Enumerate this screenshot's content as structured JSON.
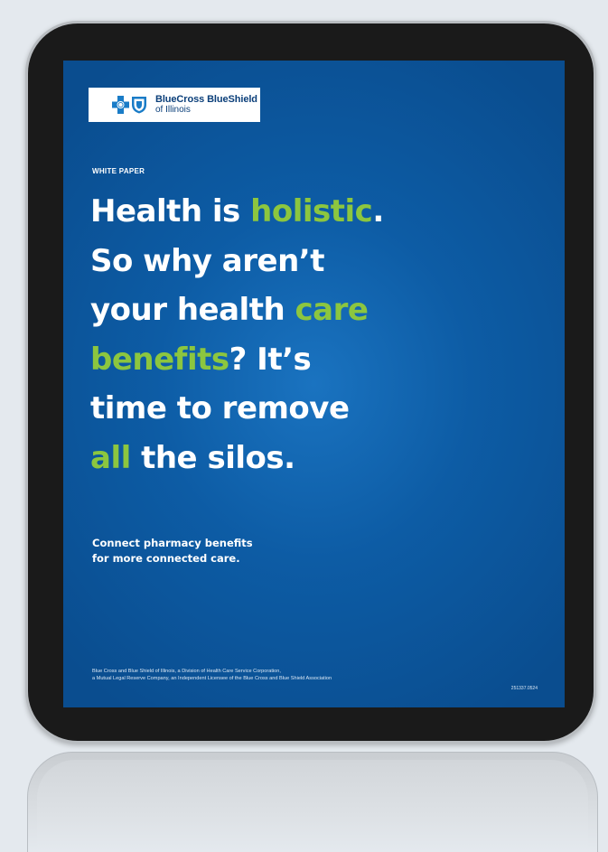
{
  "logo": {
    "brand": "BlueCross BlueShield",
    "region": "of Illinois",
    "icons": [
      "cross-icon",
      "shield-icon"
    ]
  },
  "eyebrow": "WHITE PAPER",
  "headline": {
    "lines": [
      [
        {
          "text": "Health is ",
          "highlight": false
        },
        {
          "text": "holistic",
          "highlight": true
        },
        {
          "text": ".",
          "highlight": false
        }
      ],
      [
        {
          "text": "So why aren’t",
          "highlight": false
        }
      ],
      [
        {
          "text": "your health ",
          "highlight": false
        },
        {
          "text": "care",
          "highlight": true
        }
      ],
      [
        {
          "text": "benefits",
          "highlight": true
        },
        {
          "text": "? It’s",
          "highlight": false
        }
      ],
      [
        {
          "text": "time to remove",
          "highlight": false
        }
      ],
      [
        {
          "text": "all",
          "highlight": true
        },
        {
          "text": " the silos.",
          "highlight": false
        }
      ]
    ]
  },
  "subhead": {
    "line1": "Connect pharmacy benefits",
    "line2": "for more connected care."
  },
  "footer": {
    "legal_line1": "Blue Cross and Blue Shield of Illinois, a Division of Health Care Service Corporation,",
    "legal_line2": "a Mutual Legal Reserve Company, an Independent Licensee of the Blue Cross and Blue Shield Association",
    "code": "251337.0524"
  },
  "colors": {
    "screen_blue": "#0d5ca5",
    "accent_green": "#8cc63f",
    "logo_navy": "#0b3f7a",
    "bezel": "#1a1a1a",
    "background": "#e4e9ee"
  }
}
